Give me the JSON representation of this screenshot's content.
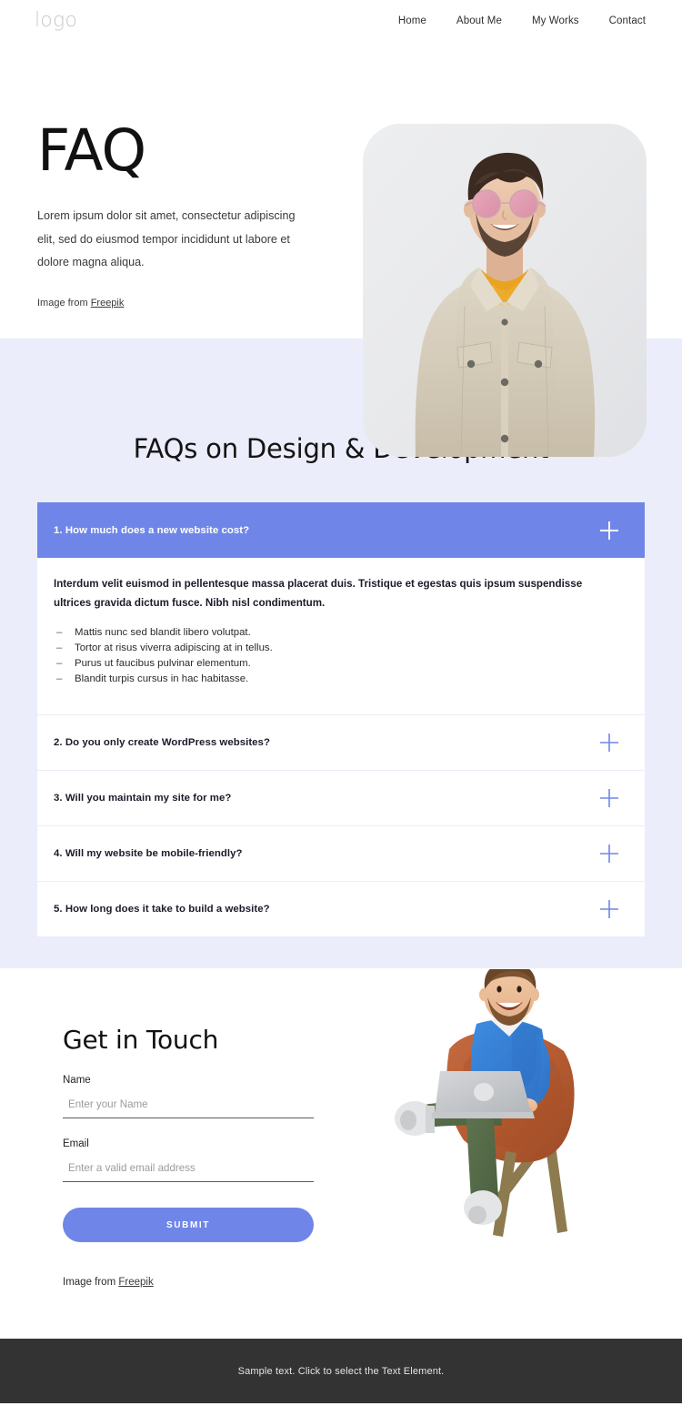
{
  "header": {
    "logo": "logo",
    "nav": [
      {
        "label": "Home"
      },
      {
        "label": "About Me"
      },
      {
        "label": "My Works"
      },
      {
        "label": "Contact"
      }
    ]
  },
  "hero": {
    "title": "FAQ",
    "paragraph": "Lorem ipsum dolor sit amet, consectetur adipiscing elit, sed do eiusmod tempor incididunt ut labore et dolore magna aliqua.",
    "credit_prefix": "Image from ",
    "credit_link": "Freepik",
    "image_alt": "smiling-man-in-sunglasses-and-beige-denim-jacket"
  },
  "faq": {
    "heading": "FAQs on Design & Development",
    "items": [
      {
        "question": "1. How much does a new website cost?",
        "open": true,
        "icon": "plus-icon",
        "answer_lead": "Interdum velit euismod in pellentesque massa placerat duis. Tristique et egestas quis ipsum suspendisse ultrices gravida dictum fusce. Nibh nisl condimentum.",
        "answer_list": [
          "Mattis nunc sed blandit libero volutpat.",
          "Tortor at risus viverra adipiscing at in tellus.",
          "Purus ut faucibus pulvinar elementum.",
          "Blandit turpis cursus in hac habitasse."
        ]
      },
      {
        "question": "2. Do you only create WordPress websites?",
        "open": false,
        "icon": "plus-icon"
      },
      {
        "question": "3. Will you maintain my site for me?",
        "open": false,
        "icon": "plus-icon"
      },
      {
        "question": "4. Will my website be mobile-friendly?",
        "open": false,
        "icon": "plus-icon"
      },
      {
        "question": "5. How long does it take to build a website?",
        "open": false,
        "icon": "plus-icon"
      }
    ]
  },
  "contact": {
    "title": "Get in Touch",
    "name_label": "Name",
    "name_placeholder": "Enter your Name",
    "name_value": "",
    "email_label": "Email",
    "email_placeholder": "Enter a valid email address",
    "email_value": "",
    "submit_label": "SUBMIT",
    "credit_prefix": "Image from ",
    "credit_link": "Freepik",
    "illustration_alt": "3d-character-with-laptop-sitting-in-armchair"
  },
  "footer": {
    "text": "Sample text. Click to select the Text Element."
  },
  "colors": {
    "accent": "#6f86e8",
    "section_bg": "#ecedfb",
    "footer_bg": "#333333",
    "logo_gray": "#c9c9c9",
    "photo_card_bg": "#e9eaec"
  }
}
